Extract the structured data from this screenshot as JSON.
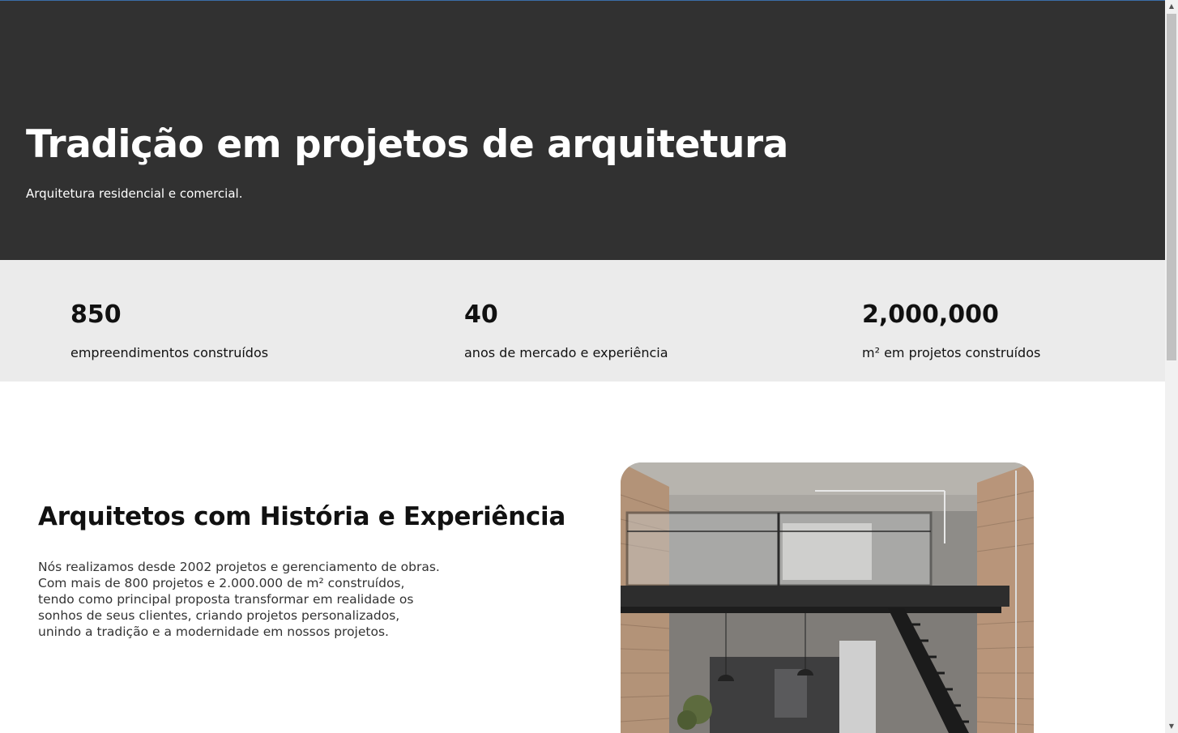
{
  "hero": {
    "title": "Tradição em projetos de arquitetura",
    "subtitle": "Arquitetura residencial e comercial."
  },
  "stats": [
    {
      "number": "850",
      "label": "empreendimentos construídos"
    },
    {
      "number": "40",
      "label": "anos de mercado e experiência"
    },
    {
      "number": "2,000,000",
      "label": "m² em projetos construídos"
    }
  ],
  "about": {
    "title": "Arquitetos com História e Experiência",
    "text": "Nós realizamos desde 2002 projetos e gerenciamento de obras. Com mais de 800 projetos e 2.000.000 de m² construídos, tendo como principal proposta transformar em realidade os sonhos de seus clientes, criando projetos personalizados, unindo a tradição e a modernidade em nossos projetos."
  },
  "colors": {
    "hero_bg": "#313131",
    "stats_bg": "#ebebeb",
    "text_dark": "#111111"
  },
  "scrollbar": {
    "up_icon": "chevron-up-icon",
    "down_icon": "chevron-down-icon"
  }
}
